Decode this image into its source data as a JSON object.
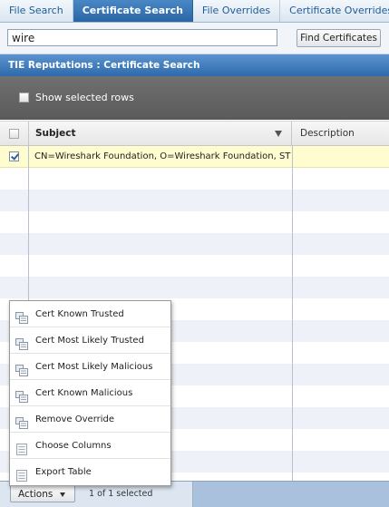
{
  "tabs": [
    {
      "label": "File Search",
      "active": false
    },
    {
      "label": "Certificate Search",
      "active": true
    },
    {
      "label": "File Overrides",
      "active": false
    },
    {
      "label": "Certificate Overrides",
      "active": false
    }
  ],
  "search": {
    "value": "wire",
    "button_label": "Find Certificates"
  },
  "section": {
    "title": "TIE Reputations : Certificate Search"
  },
  "options": {
    "show_selected_label": "Show selected rows"
  },
  "grid": {
    "columns": [
      "Subject",
      "Description"
    ],
    "rows": [
      {
        "selected": true,
        "subject": "CN=Wireshark Foundation, O=Wireshark Foundation, ST=California, L=Davis, C=US",
        "description": ""
      }
    ]
  },
  "menu": {
    "items": [
      {
        "label": "Cert Known Trusted",
        "icon": "override-icon"
      },
      {
        "label": "Cert Most Likely Trusted",
        "icon": "override-icon"
      },
      {
        "label": "Cert Most Likely Malicious",
        "icon": "override-icon"
      },
      {
        "label": "Cert Known Malicious",
        "icon": "override-icon"
      },
      {
        "label": "Remove Override",
        "icon": "override-icon"
      },
      {
        "label": "Choose Columns",
        "icon": "list-icon"
      },
      {
        "label": "Export Table",
        "icon": "list-icon"
      }
    ]
  },
  "footer": {
    "actions_label": "Actions",
    "selected_count": "1 of 1 selected"
  },
  "colors": {
    "active_tab": "#2a66a6",
    "selected_row": "#fffccf",
    "section_header": "#2e6aab"
  }
}
